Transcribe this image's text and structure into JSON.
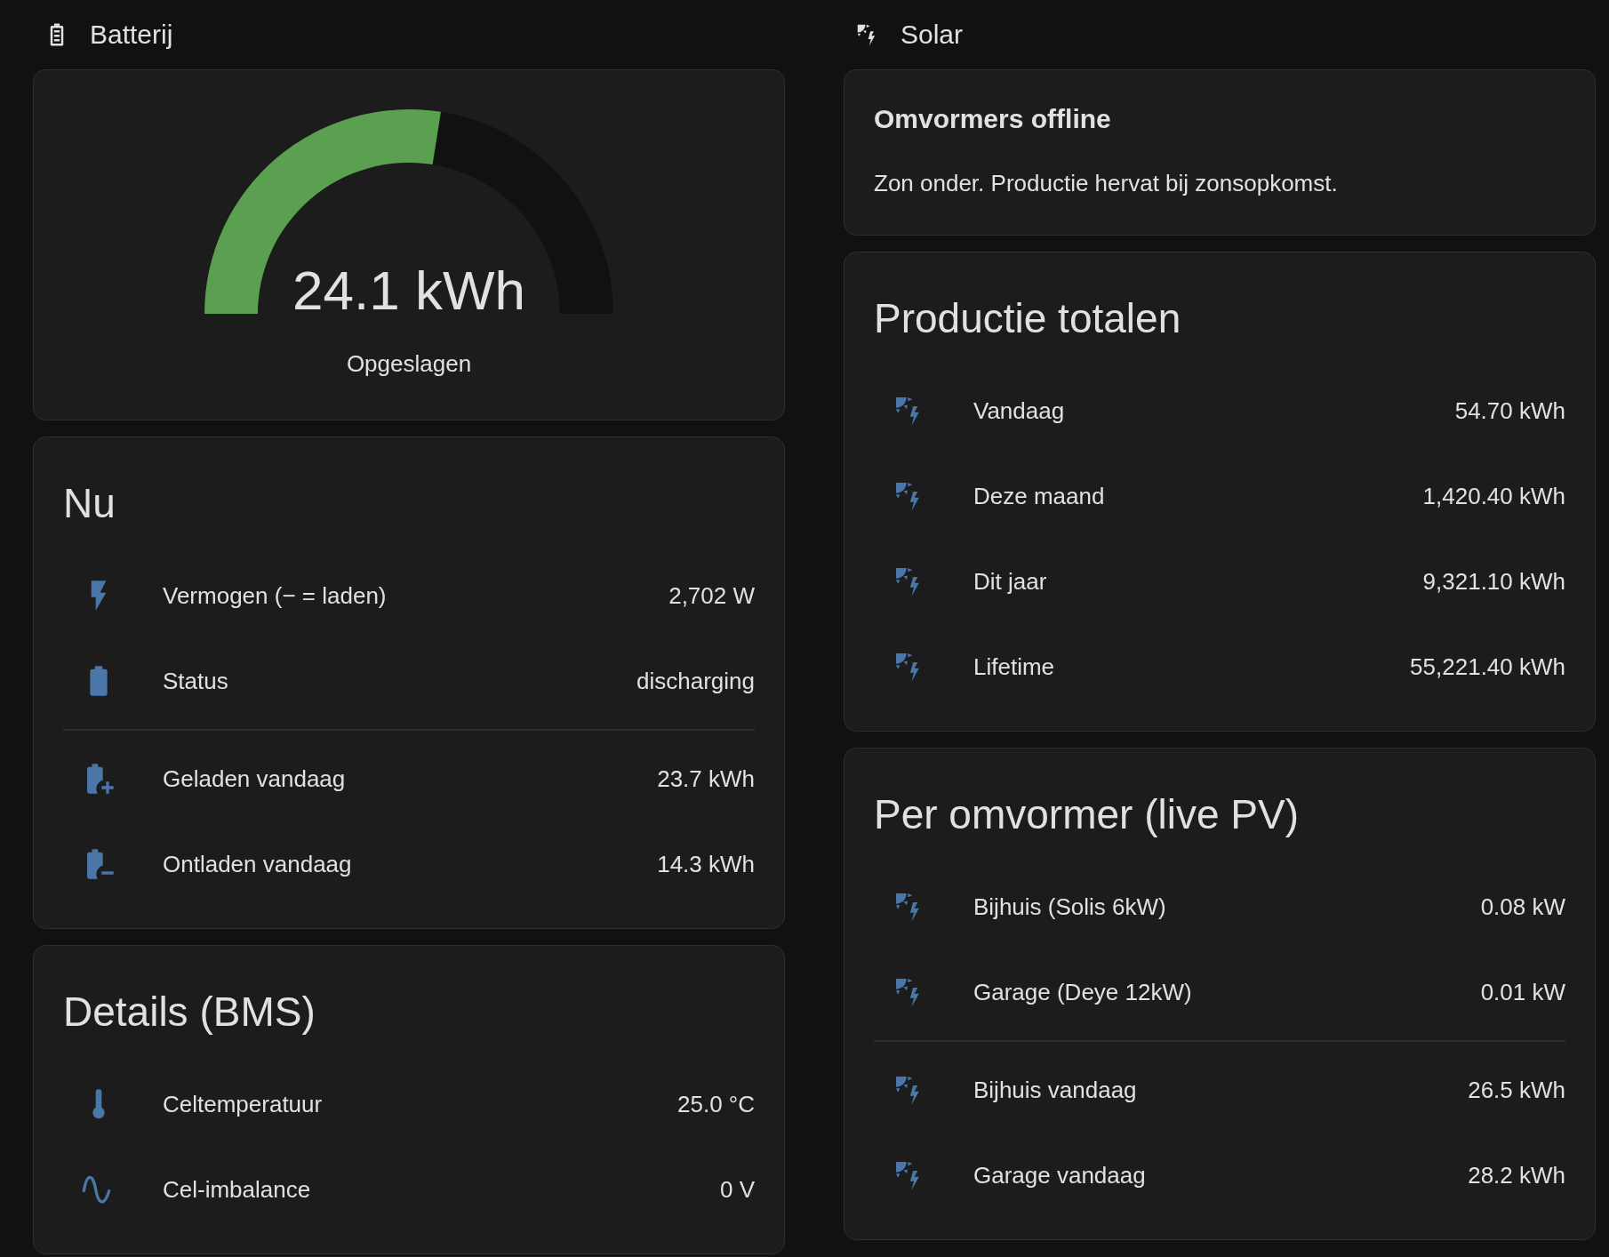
{
  "sections": [
    {
      "title": "Batterij",
      "kind": "battery",
      "cards": [
        {
          "kind": "gauge",
          "value": "24.1 kWh",
          "label": "Opgeslagen",
          "level": 0.55
        },
        {
          "kind": "entities",
          "title": "Nu",
          "rows": [
            {
              "kind": "power",
              "name": "Vermogen (− = laden)",
              "value": "2,702 W"
            },
            {
              "kind": "battery",
              "name": "Status",
              "value": "discharging"
            },
            {
              "kind": "divider"
            },
            {
              "kind": "charge",
              "name": "Geladen vandaag",
              "value": "23.7 kWh"
            },
            {
              "kind": "discharge",
              "name": "Ontladen vandaag",
              "value": "14.3 kWh"
            }
          ]
        },
        {
          "kind": "entities",
          "title": "Details (BMS)",
          "rows": [
            {
              "kind": "temperature",
              "name": "Celtemperatuur",
              "value": "25.0 °C"
            },
            {
              "kind": "wave",
              "name": "Cel-imbalance",
              "value": "0 V"
            }
          ]
        }
      ]
    },
    {
      "title": "Solar",
      "kind": "solar",
      "cards": [
        {
          "kind": "markdown",
          "heading": "Omvormers offline",
          "text": "Zon onder. Productie hervat bij zonsopkomst."
        },
        {
          "kind": "entities",
          "title": "Productie totalen",
          "rows": [
            {
              "kind": "solar",
              "name": "Vandaag",
              "value": "54.70 kWh"
            },
            {
              "kind": "solar",
              "name": "Deze maand",
              "value": "1,420.40 kWh"
            },
            {
              "kind": "solar",
              "name": "Dit jaar",
              "value": "9,321.10 kWh"
            },
            {
              "kind": "solar",
              "name": "Lifetime",
              "value": "55,221.40 kWh"
            }
          ]
        },
        {
          "kind": "entities",
          "title": "Per omvormer (live PV)",
          "rows": [
            {
              "kind": "solar",
              "name": "Bijhuis (Solis 6kW)",
              "value": "0.08 kW"
            },
            {
              "kind": "solar",
              "name": "Garage (Deye 12kW)",
              "value": "0.01 kW"
            },
            {
              "kind": "divider"
            },
            {
              "kind": "solar",
              "name": "Bijhuis vandaag",
              "value": "26.5 kWh"
            },
            {
              "kind": "solar",
              "name": "Garage vandaag",
              "value": "28.2 kWh"
            }
          ]
        }
      ]
    }
  ]
}
